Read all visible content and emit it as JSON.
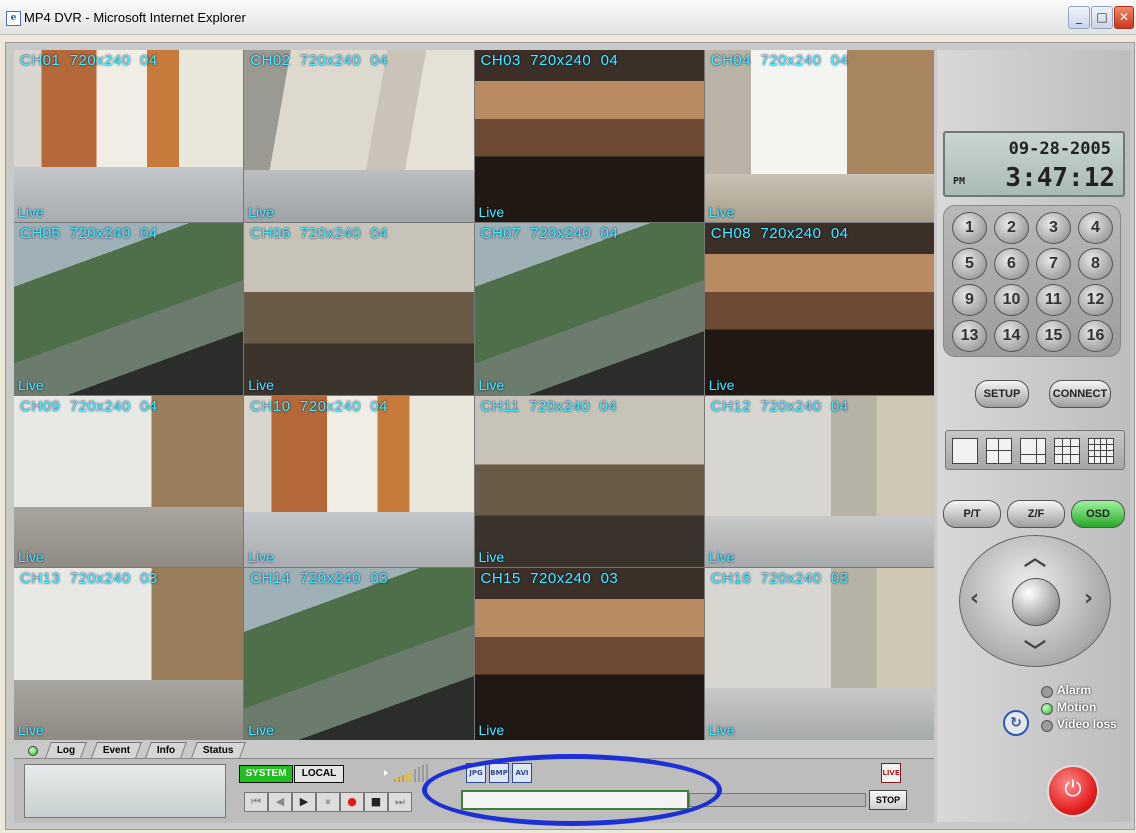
{
  "window": {
    "title": "MP4 DVR - Microsoft Internet Explorer",
    "icon": "ie-page-icon",
    "controls": [
      "minimize",
      "maximize",
      "close"
    ]
  },
  "cameras": [
    {
      "label": "CH01  720x240  04",
      "status": "Live",
      "scene": "door"
    },
    {
      "label": "CH02  720x240  04",
      "status": "Live",
      "scene": "hall"
    },
    {
      "label": "CH03  720x240  04",
      "status": "Live",
      "scene": "car"
    },
    {
      "label": "CH04  720x240  04",
      "status": "Live",
      "scene": "office"
    },
    {
      "label": "CH05  720x240  04",
      "status": "Live",
      "scene": "street"
    },
    {
      "label": "CH06  720x240  04",
      "status": "Live",
      "scene": "lab"
    },
    {
      "label": "CH07  720x240  04",
      "status": "Live",
      "scene": "street"
    },
    {
      "label": "CH08  720x240  04",
      "status": "Live",
      "scene": "car"
    },
    {
      "label": "CH09  720x240  04",
      "status": "Live",
      "scene": "win"
    },
    {
      "label": "CH10  720x240  04",
      "status": "Live",
      "scene": "door"
    },
    {
      "label": "CH11  720x240  04",
      "status": "Live",
      "scene": "lab"
    },
    {
      "label": "CH12  720x240  04",
      "status": "Live",
      "scene": "corr"
    },
    {
      "label": "CH13  720x240  03",
      "status": "Live",
      "scene": "win"
    },
    {
      "label": "CH14  720x240  03",
      "status": "Live",
      "scene": "street"
    },
    {
      "label": "CH15  720x240  03",
      "status": "Live",
      "scene": "car"
    },
    {
      "label": "CH16  720x240  03",
      "status": "Live",
      "scene": "corr"
    }
  ],
  "clock": {
    "date": "09-28-2005",
    "ampm": "PM",
    "time": "3:47:12"
  },
  "keypad": [
    "1",
    "2",
    "3",
    "4",
    "5",
    "6",
    "7",
    "8",
    "9",
    "10",
    "11",
    "12",
    "13",
    "14",
    "15",
    "16"
  ],
  "panel": {
    "setup_label": "SETUP",
    "connect_label": "CONNECT",
    "pt_label": "P/T",
    "zf_label": "Z/F",
    "osd_label": "OSD",
    "layouts": [
      "1x1",
      "2x2",
      "1+5",
      "3x3",
      "4x4"
    ],
    "status": [
      {
        "label": "Alarm",
        "active": false
      },
      {
        "label": "Motion",
        "active": true
      },
      {
        "label": "Video loss",
        "active": false
      }
    ]
  },
  "tabs": [
    "Log",
    "Event",
    "Info",
    "Status"
  ],
  "bottom": {
    "system_label": "SYSTEM",
    "local_label": "LOCAL",
    "stop_label": "STOP",
    "file_icons": [
      "JPG",
      "BMP",
      "AVI"
    ],
    "live_badge": "LIVE"
  },
  "colors": {
    "osd_text": "#3ff0ff",
    "system_active": "#1fc01f",
    "annotation_ellipse": "#1e2fd6",
    "power": "#e11c1c"
  }
}
